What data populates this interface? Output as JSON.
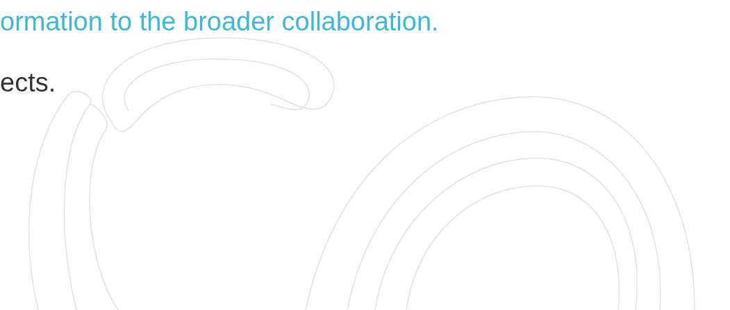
{
  "lines": [
    {
      "text": "ormation to the broader collaboration.",
      "kind": "accent"
    },
    {
      "text": "ects.",
      "kind": "body"
    }
  ]
}
